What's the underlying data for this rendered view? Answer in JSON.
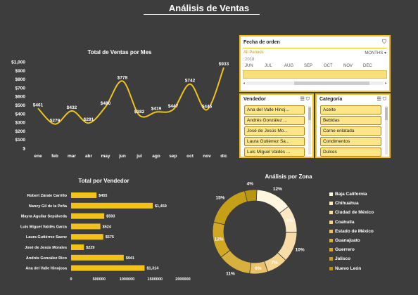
{
  "page": {
    "title": "Análisis de Ventas"
  },
  "line_chart": {
    "title": "Total de Ventas por Mes",
    "y_ticks": [
      "$1,000",
      "$900",
      "$800",
      "$700",
      "$600",
      "$500",
      "$400",
      "$300",
      "$200",
      "$100",
      "$"
    ],
    "months": [
      "ene",
      "feb",
      "mar",
      "abr",
      "may",
      "jun",
      "jul",
      "ago",
      "sep",
      "oct",
      "nov",
      "dic"
    ],
    "values": [
      461,
      279,
      432,
      291,
      480,
      778,
      382,
      419,
      447,
      742,
      445,
      933
    ],
    "labels": [
      "$461",
      "$279",
      "$432",
      "$291",
      "$480",
      "$778",
      "$382",
      "$419",
      "$447",
      "$742",
      "$445",
      "$933"
    ],
    "color": "#f2c21b"
  },
  "date_slicer": {
    "title": "Fecha de orden",
    "filter_label": "All Periods",
    "period_label": "MONTHS",
    "year": "2018",
    "months": [
      "JUN",
      "JUL",
      "AUG",
      "SEP",
      "OCT",
      "NOV",
      "DEC"
    ]
  },
  "vendedor_slicer": {
    "title": "Vendedor",
    "items": [
      "Ana del Valle Hinoj...",
      "Andrés González ...",
      "José de Jesús Mo...",
      "Laura Gutiérrez Sa...",
      "Luis Miguel Valdés ..."
    ]
  },
  "categoria_slicer": {
    "title": "Categoría",
    "items": [
      "Aceite",
      "Bebidas",
      "Carne enlatada",
      "Condimentos",
      "Dulces"
    ]
  },
  "bar_chart": {
    "title": "Total por Vendedor",
    "names": [
      "Robert Zárate Carrillo",
      "Nancy Gil de la Peña",
      "Mayra Aguilar Sepúlveda",
      "Luis Miguel Valdés Garza",
      "Laura Gutiérrez Saenz",
      "José de Jesús Morales",
      "Andrés González Rico",
      "Ana del Valle Hinojosa"
    ],
    "values": [
      455,
      1459,
      593,
      524,
      575,
      229,
      941,
      1314
    ],
    "labels": [
      "$455",
      "$1,459",
      "$593",
      "$524",
      "$575",
      "$229",
      "$941",
      "$1,314"
    ],
    "x_ticks": [
      "0",
      "500000",
      "1000000",
      "1500000",
      "2000000"
    ],
    "color": "#f2c21b"
  },
  "donut_chart": {
    "title": "Análisis por Zona",
    "legend": [
      "Baja California",
      "Chihuahua",
      "Ciudad de México",
      "Coahuila",
      "Estado de México",
      "Guanajuato",
      "Guerrero",
      "Jalisco",
      "Nuevo León"
    ],
    "colors": [
      "#fff6de",
      "#fde8c4",
      "#f7dca8",
      "#f5d48e",
      "#e8c16a",
      "#d8b03e",
      "#d2a822",
      "#c59f17",
      "#b8960f"
    ],
    "slice_labels": [
      "12%",
      "9%",
      "10%",
      "7%",
      "6%",
      "11%",
      "12%",
      "15%",
      "4%"
    ]
  },
  "chart_data": [
    {
      "type": "line",
      "title": "Total de Ventas por Mes",
      "x": [
        "ene",
        "feb",
        "mar",
        "abr",
        "may",
        "jun",
        "jul",
        "ago",
        "sep",
        "oct",
        "nov",
        "dic"
      ],
      "values": [
        461,
        279,
        432,
        291,
        480,
        778,
        382,
        419,
        447,
        742,
        445,
        933
      ],
      "ylim": [
        0,
        1000
      ]
    },
    {
      "type": "bar",
      "title": "Total por Vendedor",
      "categories": [
        "Robert Zárate Carrillo",
        "Nancy Gil de la Peña",
        "Mayra Aguilar Sepúlveda",
        "Luis Miguel Valdés Garza",
        "Laura Gutiérrez Saenz",
        "José de Jesús Morales",
        "Andrés González Rico",
        "Ana del Valle Hinojosa"
      ],
      "values": [
        455000,
        1459000,
        593000,
        524000,
        575000,
        229000,
        941000,
        1314000
      ],
      "xlim": [
        0,
        2000000
      ]
    },
    {
      "type": "pie",
      "title": "Análisis por Zona",
      "categories": [
        "Baja California",
        "Chihuahua",
        "Ciudad de México",
        "Coahuila",
        "Estado de México",
        "Guanajuato",
        "Guerrero",
        "Jalisco",
        "Nuevo León"
      ],
      "values": [
        12,
        9,
        10,
        7,
        6,
        11,
        12,
        15,
        4
      ]
    }
  ]
}
